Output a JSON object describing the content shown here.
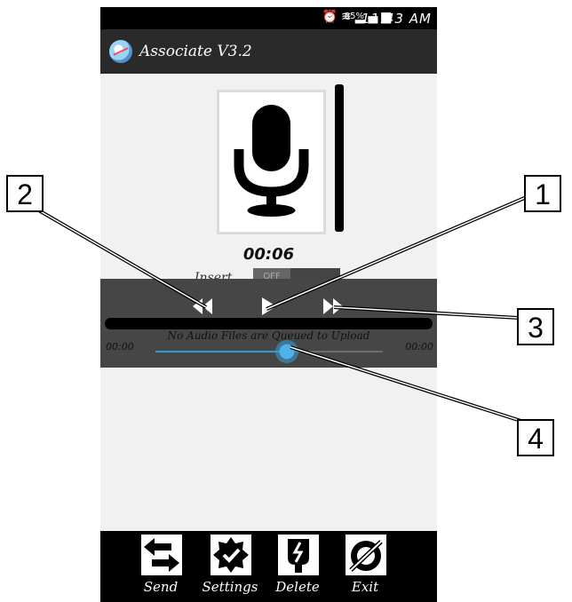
{
  "status_bar": {
    "icons": [
      "alarm-icon",
      "wifi-icon",
      "signal-icon",
      "battery-icon"
    ],
    "battery": "85%",
    "time": "11:43 AM"
  },
  "app_bar": {
    "title": "Associate V3.2"
  },
  "recorder": {
    "timer": "00:06",
    "insert_label": "Insert",
    "insert_state": "OFF"
  },
  "player": {
    "upload_status": "No Audio Files are Queued to Upload",
    "time_elapsed": "00:00",
    "time_total": "00:00",
    "seek_fraction": 0.58
  },
  "actions": [
    {
      "label": "Send",
      "icon": "swap-arrows-icon"
    },
    {
      "label": "Settings",
      "icon": "settings-badge-icon"
    },
    {
      "label": "Delete",
      "icon": "delete-icon"
    },
    {
      "label": "Exit",
      "icon": "exit-icon"
    }
  ],
  "callouts": [
    "2",
    "1",
    "3",
    "4"
  ],
  "colors": {
    "accent": "#2e9bd6",
    "app_bar": "#2a2a2a",
    "player_bg": "#464646",
    "background": "#f1f1f1"
  }
}
